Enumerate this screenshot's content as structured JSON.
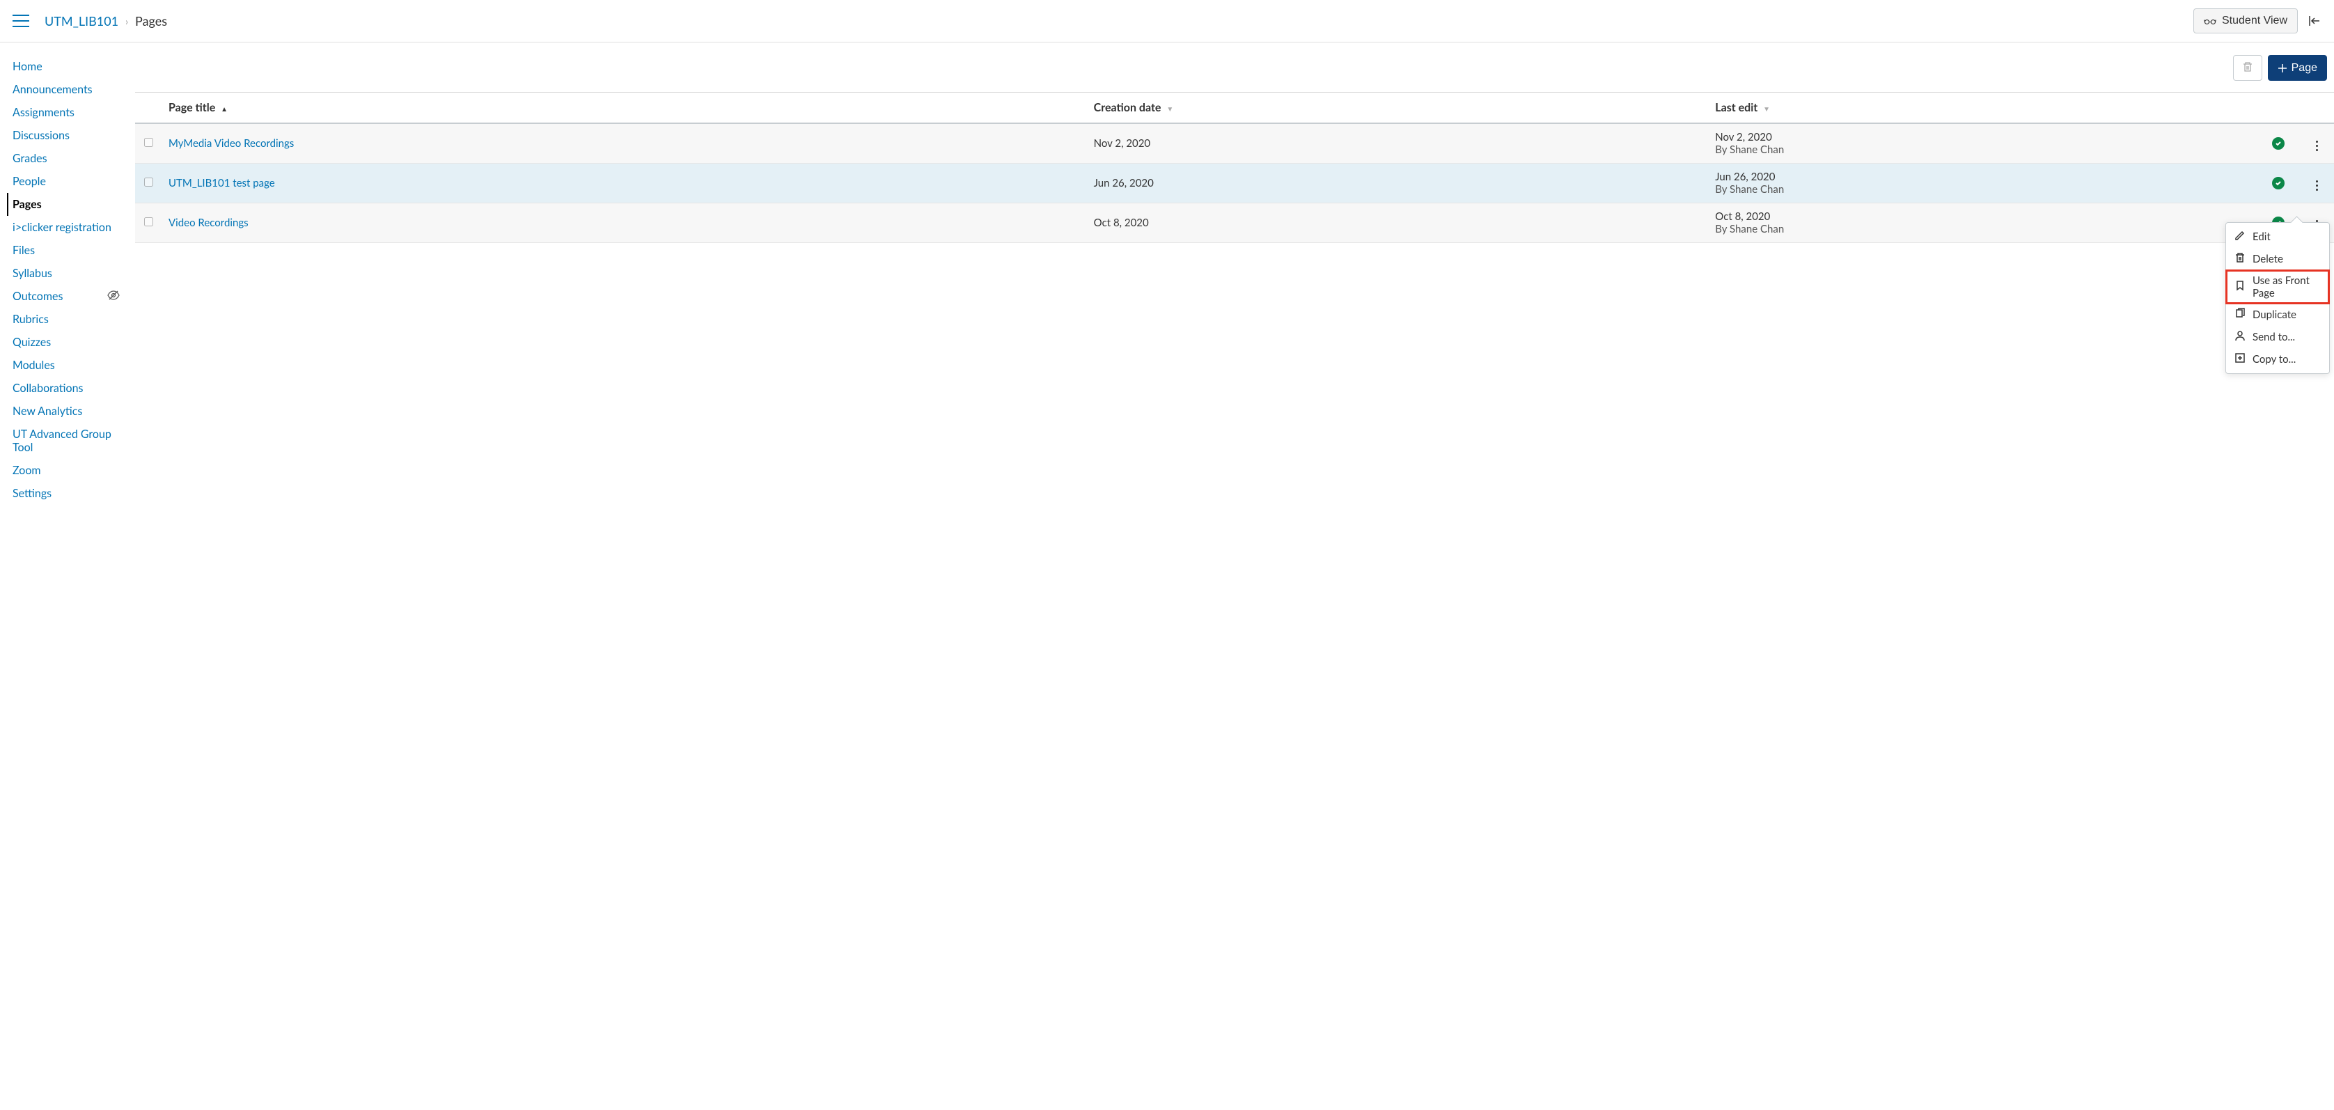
{
  "breadcrumb": {
    "course": "UTM_LIB101",
    "current": "Pages"
  },
  "header": {
    "student_view": "Student View"
  },
  "sidebar": {
    "items": [
      {
        "label": "Home",
        "active": false,
        "hidden": false
      },
      {
        "label": "Announcements",
        "active": false,
        "hidden": false
      },
      {
        "label": "Assignments",
        "active": false,
        "hidden": false
      },
      {
        "label": "Discussions",
        "active": false,
        "hidden": false
      },
      {
        "label": "Grades",
        "active": false,
        "hidden": false
      },
      {
        "label": "People",
        "active": false,
        "hidden": false
      },
      {
        "label": "Pages",
        "active": true,
        "hidden": false
      },
      {
        "label": "i>clicker registration",
        "active": false,
        "hidden": false
      },
      {
        "label": "Files",
        "active": false,
        "hidden": false
      },
      {
        "label": "Syllabus",
        "active": false,
        "hidden": false
      },
      {
        "label": "Outcomes",
        "active": false,
        "hidden": true
      },
      {
        "label": "Rubrics",
        "active": false,
        "hidden": false
      },
      {
        "label": "Quizzes",
        "active": false,
        "hidden": false
      },
      {
        "label": "Modules",
        "active": false,
        "hidden": false
      },
      {
        "label": "Collaborations",
        "active": false,
        "hidden": false
      },
      {
        "label": "New Analytics",
        "active": false,
        "hidden": false
      },
      {
        "label": "UT Advanced Group Tool",
        "active": false,
        "hidden": false
      },
      {
        "label": "Zoom",
        "active": false,
        "hidden": false
      },
      {
        "label": "Settings",
        "active": false,
        "hidden": false
      }
    ]
  },
  "toolbar": {
    "add_page": "Page"
  },
  "table": {
    "headers": {
      "title": "Page title",
      "creation": "Creation date",
      "last_edit": "Last edit"
    },
    "rows": [
      {
        "title": "MyMedia Video Recordings",
        "creation": "Nov 2, 2020",
        "last_edit_date": "Nov 2, 2020",
        "last_edit_by": "By Shane Chan",
        "highlighted": false
      },
      {
        "title": "UTM_LIB101 test page",
        "creation": "Jun 26, 2020",
        "last_edit_date": "Jun 26, 2020",
        "last_edit_by": "By Shane Chan",
        "highlighted": true
      },
      {
        "title": "Video Recordings",
        "creation": "Oct 8, 2020",
        "last_edit_date": "Oct 8, 2020",
        "last_edit_by": "By Shane Chan",
        "highlighted": false
      }
    ]
  },
  "context_menu": {
    "items": [
      {
        "label": "Edit",
        "icon": "pencil",
        "highlighted": false
      },
      {
        "label": "Delete",
        "icon": "trash",
        "highlighted": false
      },
      {
        "label": "Use as Front Page",
        "icon": "bookmark",
        "highlighted": true
      },
      {
        "label": "Duplicate",
        "icon": "duplicate",
        "highlighted": false
      },
      {
        "label": "Send to...",
        "icon": "user",
        "highlighted": false
      },
      {
        "label": "Copy to...",
        "icon": "copy",
        "highlighted": false
      }
    ]
  }
}
